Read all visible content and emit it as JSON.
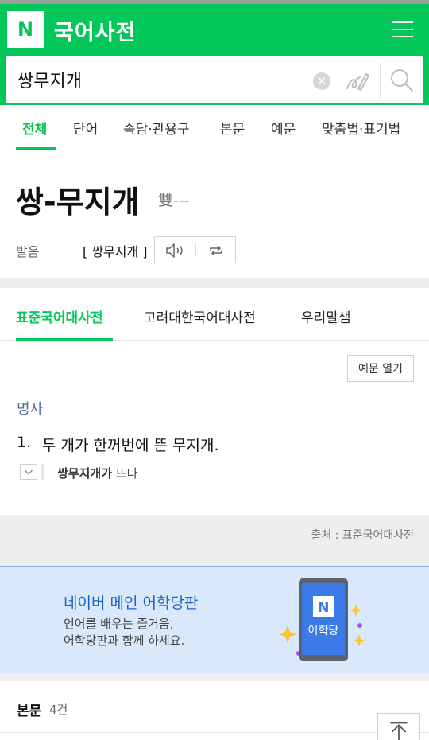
{
  "header": {
    "logo_letter": "N",
    "title": "국어사전",
    "menu_icon": "hamburger-menu-icon",
    "brand_color": "#04c75a"
  },
  "search": {
    "value": "쌍무지개",
    "clear_icon": "clear-icon",
    "handwriting_icon": "handwriting-icon",
    "search_icon": "search-icon"
  },
  "tabs": [
    {
      "label": "전체",
      "active": true
    },
    {
      "label": "단어",
      "active": false
    },
    {
      "label": "속담·관용구",
      "active": false
    },
    {
      "label": "본문",
      "active": false
    },
    {
      "label": "예문",
      "active": false
    },
    {
      "label": "맞춤법·표기법",
      "active": false
    }
  ],
  "entry": {
    "word": "쌍-무지개",
    "hanja": "雙---",
    "pronunciation_label": "발음",
    "pronunciation": "[ 쌍무지개 ]",
    "speaker_icon": "speaker-icon",
    "repeat_icon": "repeat-icon"
  },
  "dict_tabs": [
    {
      "label": "표준국어대사전",
      "active": true
    },
    {
      "label": "고려대한국어대사전",
      "active": false
    },
    {
      "label": "우리말샘",
      "active": false
    }
  ],
  "definition": {
    "example_button": "예문 열기",
    "part_of_speech": "명사",
    "number": "1.",
    "text": "두 개가 한꺼번에 뜬 무지개.",
    "example_bold": "쌍무지개가",
    "example_rest": " 뜨다",
    "expand_icon": "chevron-down-icon"
  },
  "source": {
    "text": "출처 : 표준국어대사전"
  },
  "banner": {
    "title": "네이버 메인 어학당판",
    "line1": "언어를 배우는 즐거움,",
    "line2": "어학당판과 함께 하세요.",
    "phone_logo": "N",
    "phone_label": "어학당",
    "accent_color": "#1a62c8"
  },
  "body_section": {
    "label": "본문",
    "count": "4건",
    "top_icon": "arrow-up-icon"
  }
}
